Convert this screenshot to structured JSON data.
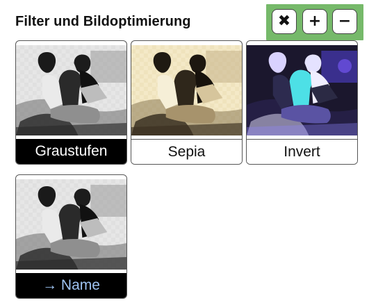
{
  "panel": {
    "title": "Filter und Bildoptimierung"
  },
  "toolbar": {
    "highlight_color": "#76b96a",
    "buttons": [
      {
        "icon": "close-icon",
        "glyph": "✖"
      },
      {
        "icon": "plus-icon",
        "glyph": "+"
      },
      {
        "icon": "minus-icon",
        "glyph": "−"
      }
    ]
  },
  "filters": [
    {
      "label": "Graustufen",
      "style": "grayscale",
      "selected": true
    },
    {
      "label": "Sepia",
      "style": "sepia",
      "selected": false
    },
    {
      "label": "Invert",
      "style": "invert",
      "selected": false
    },
    {
      "label": "→ Name",
      "style": "grayscale",
      "selected": false,
      "link_color": "#9ec3f2"
    }
  ]
}
